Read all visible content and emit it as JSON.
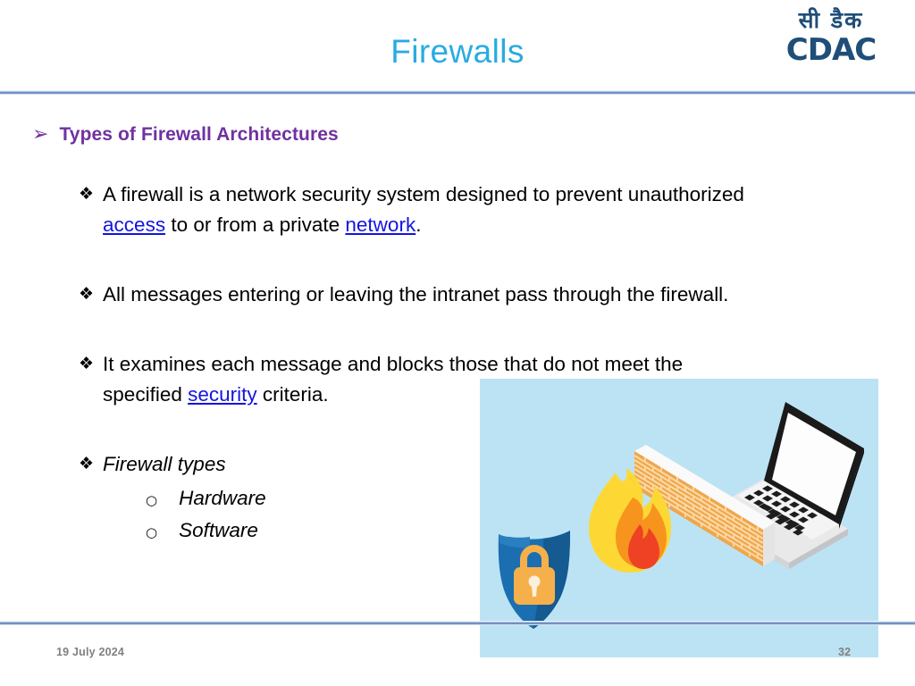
{
  "header": {
    "title": "Firewalls",
    "title_color": "#29ABE2",
    "logo": {
      "devanagari": "सी डैक",
      "wordmark": "CDAC",
      "color": "#1F4E79"
    }
  },
  "content": {
    "heading": {
      "bullet_glyph": "➢",
      "text": "Types of Firewall Architectures",
      "color": "#7031A0"
    },
    "diamond_glyph": "❖",
    "circle_glyph": "○",
    "link_color": "#1414E0",
    "bullets": [
      {
        "id": "definition",
        "segments": [
          {
            "text": "A firewall is a network security system designed to prevent unauthorized ",
            "link": false
          },
          {
            "text": "access",
            "link": true
          },
          {
            "text": " to or from a private ",
            "link": false
          },
          {
            "text": "network",
            "link": true
          },
          {
            "text": ".",
            "link": false
          }
        ]
      },
      {
        "id": "all-messages",
        "segments": [
          {
            "text": "All messages entering or leaving the intranet pass through the firewall.",
            "link": false
          }
        ]
      },
      {
        "id": "examines",
        "segments": [
          {
            "text": "It examines each message and blocks those that do not meet the specified ",
            "link": false
          },
          {
            "text": "security",
            "link": true
          },
          {
            "text": " criteria.",
            "link": false
          }
        ]
      },
      {
        "id": "firewall-types",
        "italic": true,
        "segments": [
          {
            "text": "Firewall types",
            "link": false
          }
        ],
        "sub_items": [
          "Hardware",
          "Software"
        ]
      }
    ]
  },
  "illustration": {
    "name": "firewall-concept-illustration",
    "background_color": "#BCE3F4",
    "elements": [
      "shield-padlock",
      "flame",
      "brick-wall",
      "laptop"
    ],
    "colors": {
      "shield": "#1B6FB0",
      "shield_dark": "#155A90",
      "padlock": "#F5B04C",
      "flame_yellow": "#FDD835",
      "flame_orange": "#F7941E",
      "flame_red": "#EF4123",
      "brick": "#F0A64B",
      "brick_mortar": "#FBD9A5",
      "wall_side": "#EDEDED",
      "laptop_body": "#F2F2F2",
      "laptop_bezel": "#1A1A1A",
      "laptop_screen": "#FFFFFF"
    }
  },
  "footer": {
    "date": "19 July 2024",
    "slide_number": "32",
    "color": "#808080"
  }
}
